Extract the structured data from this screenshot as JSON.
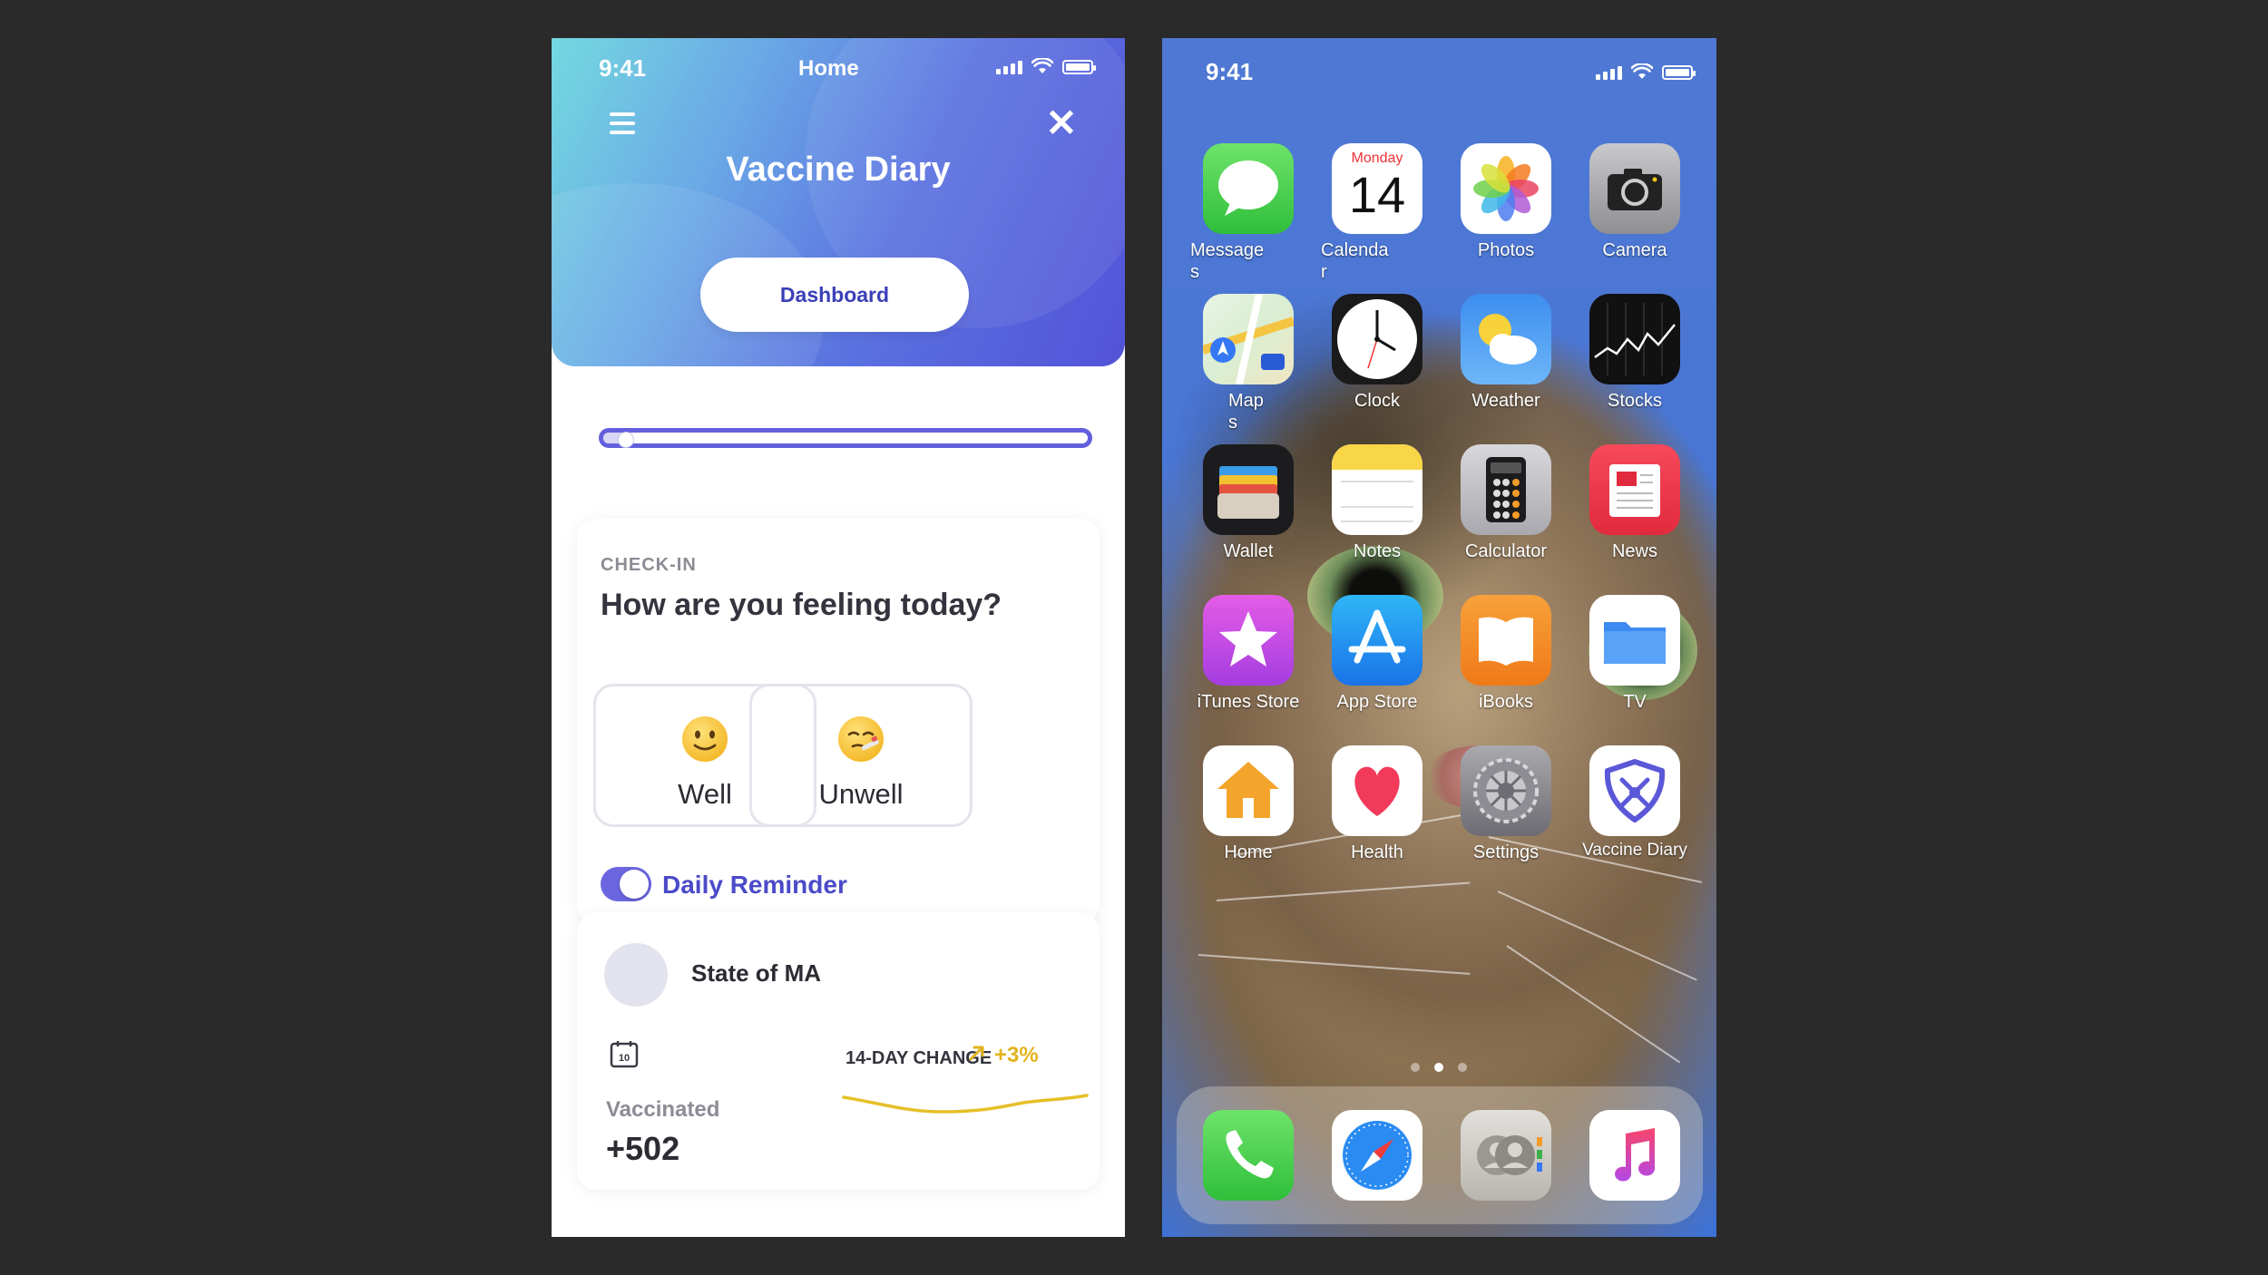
{
  "app": {
    "status_time": "9:41",
    "status_center": "Home",
    "title": "Vaccine Diary",
    "dashboard_button": "Dashboard",
    "slider_value_fraction": 0.03,
    "checkin": {
      "label": "CHECK-IN",
      "question": "How are you feeling today?",
      "options": [
        "Well",
        "Unwell"
      ],
      "reminder_label": "Daily Reminder",
      "reminder_on": true
    },
    "state_card": {
      "name": "State of MA",
      "calendar_day": "10",
      "metric_label": "Vaccinated",
      "metric_value": "+502",
      "change_label": "14-DAY CHANGE",
      "change_value": "+3%",
      "change_color": "#e2b31c"
    },
    "accent": "#5b58d8"
  },
  "home": {
    "status_time": "9:41",
    "calendar_weekday": "Monday",
    "calendar_day": "14",
    "apps": [
      {
        "label": "Message\ns",
        "icon": "messages-icon"
      },
      {
        "label": "Calenda\nr",
        "icon": "calendar-icon"
      },
      {
        "label": "Photos",
        "icon": "photos-icon"
      },
      {
        "label": "Camera",
        "icon": "camera-icon"
      },
      {
        "label": "Map\ns",
        "icon": "maps-icon"
      },
      {
        "label": "Clock",
        "icon": "clock-icon"
      },
      {
        "label": "Weather",
        "icon": "weather-icon"
      },
      {
        "label": "Stocks",
        "icon": "stocks-icon"
      },
      {
        "label": "Wallet",
        "icon": "wallet-icon"
      },
      {
        "label": "Notes",
        "icon": "notes-icon"
      },
      {
        "label": "Calculator",
        "icon": "calculator-icon"
      },
      {
        "label": "News",
        "icon": "news-icon"
      },
      {
        "label": "iTunes Store",
        "icon": "itunes-store-icon"
      },
      {
        "label": "App Store",
        "icon": "app-store-icon"
      },
      {
        "label": "iBooks",
        "icon": "ibooks-icon"
      },
      {
        "label": "TV",
        "icon": "files-icon"
      },
      {
        "label": "Home",
        "icon": "home-app-icon"
      },
      {
        "label": "Health",
        "icon": "health-icon"
      },
      {
        "label": "Settings",
        "icon": "settings-icon"
      },
      {
        "label": "Vaccine Diary",
        "icon": "vaccine-diary-icon"
      }
    ],
    "dock": [
      "phone-icon",
      "safari-icon",
      "contacts-icon",
      "music-icon"
    ],
    "page_count": 3,
    "current_page": 2
  }
}
